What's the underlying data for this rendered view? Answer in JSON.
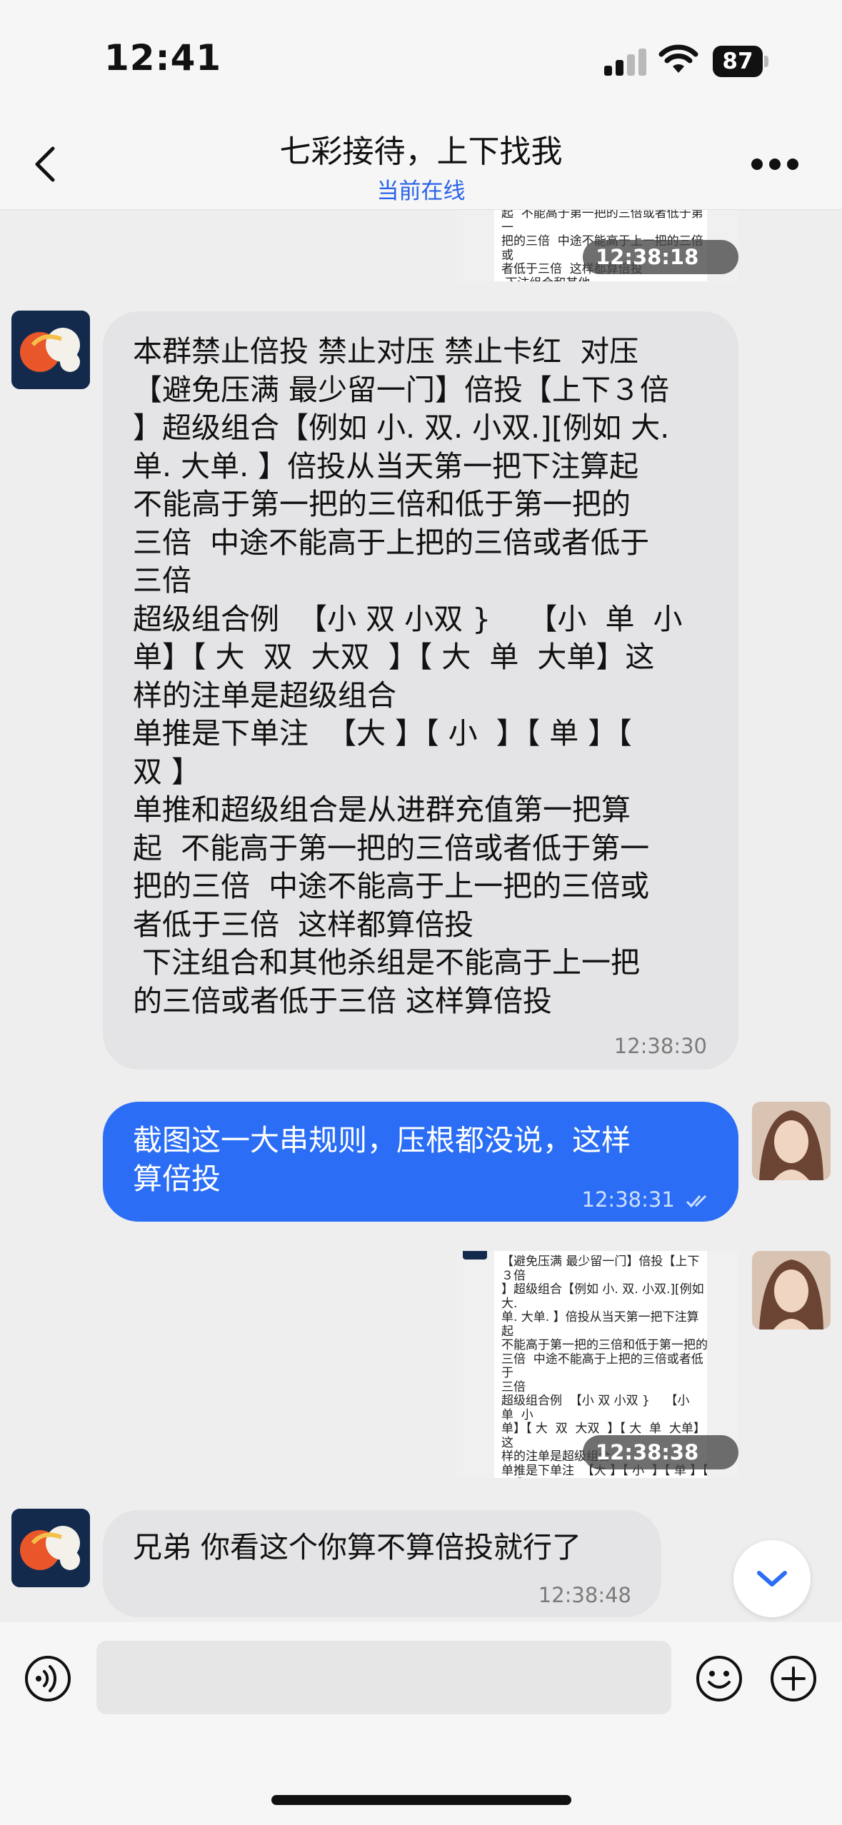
{
  "status_bar": {
    "time": "12:41",
    "battery": "87"
  },
  "header": {
    "title": "七彩接待，上下找我",
    "subtitle": "当前在线"
  },
  "messages": [
    {
      "type": "image",
      "direction": "outgoing",
      "thumb_text": "起  不能高于第一把的三倍或者低于第一\n把的三倍  中途不能高于上一把的三倍或\n者低于三倍  这样都算倍投\n 下注组合和其他\n的三倍或者低于",
      "time": "12:38:18"
    },
    {
      "type": "text",
      "direction": "incoming",
      "text": "本群禁止倍投 禁止对压 禁止卡红  对压\n【避免压满 最少留一门】倍投【上下３倍\n】超级组合【例如 小. 双. 小双.][例如 大.\n单. 大单. 】倍投从当天第一把下注算起\n不能高于第一把的三倍和低于第一把的\n三倍  中途不能高于上把的三倍或者低于\n三倍\n超级组合例  【小 双 小双 }    【小  单  小\n单】【 大  双  大双  】【 大  单  大单】这\n样的注单是超级组合\n单推是下单注  【大 】【 小  】【 单 】【\n双 】\n单推和超级组合是从进群充值第一把算\n起  不能高于第一把的三倍或者低于第一\n把的三倍  中途不能高于上一把的三倍或\n者低于三倍  这样都算倍投\n 下注组合和其他杀组是不能高于上一把\n的三倍或者低于三倍 这样算倍投",
      "time": "12:38:30"
    },
    {
      "type": "text",
      "direction": "outgoing",
      "text": "截图这一大串规则，压根都没说，这样\n算倍投",
      "time": "12:38:31"
    },
    {
      "type": "image",
      "direction": "outgoing",
      "thumb_text": "【避免压满 最少留一门】倍投【上下３倍\n】超级组合【例如 小. 双. 小双.][例如 大.\n单. 大单. 】倍投从当天第一把下注算起\n不能高于第一把的三倍和低于第一把的\n三倍  中途不能高于上把的三倍或者低于\n三倍\n超级组合例  【小 双 小双 }    【小  单  小\n单】【 大  双  大双  】【 大  单  大单】这\n样的注单是超级组合\n单推是下单注  【大 】【 小  】【 单 】【\n双 】\n单推和超级组合是从进群充值第一把算\n起  不能高于第一把的三倍或者低于第一\n把的三倍  中途不能高于上一把的三倍或\n者低于三倍  这样都算倍投\n 下注组合和其他\n的三倍或者低于",
      "time": "12:38:38"
    },
    {
      "type": "text",
      "direction": "incoming",
      "text": "兄弟 你看这个你算不算倍投就行了",
      "time": "12:38:48"
    }
  ],
  "input": {
    "placeholder": ""
  },
  "colors": {
    "accent": "#2b6ef5",
    "incoming_bubble": "#e4e4e6",
    "subtitle": "#2a63e8"
  }
}
